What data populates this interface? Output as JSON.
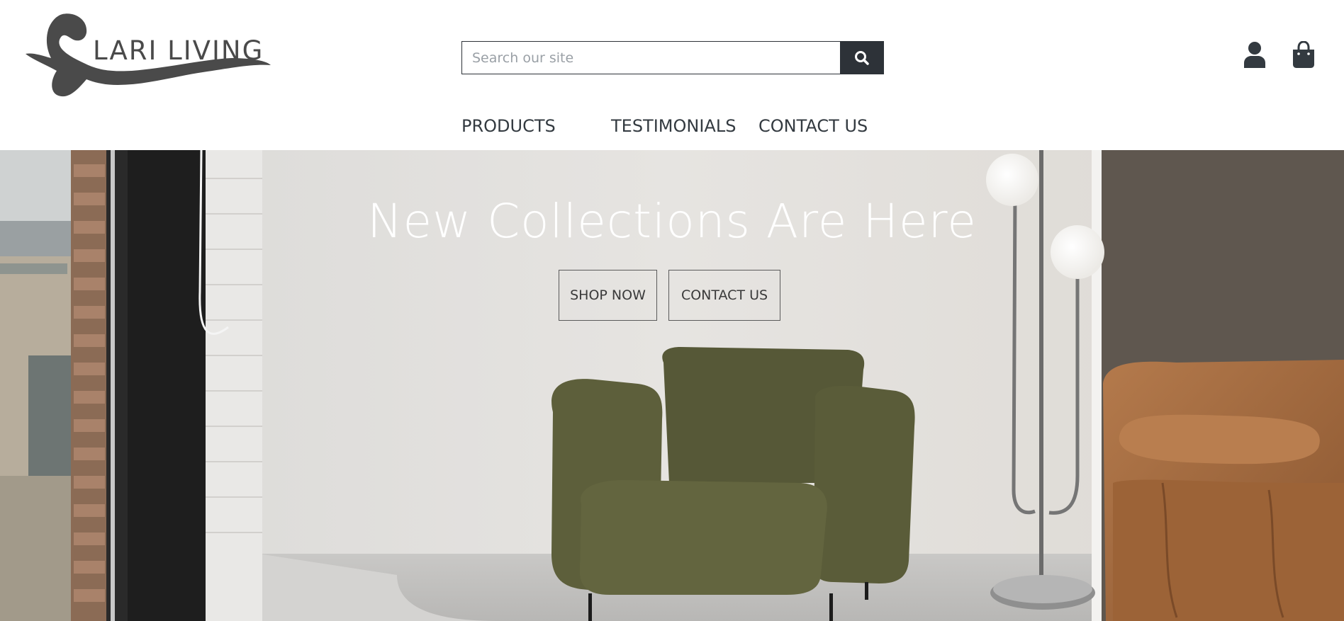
{
  "brand": {
    "name": "LARI LIVING"
  },
  "search": {
    "placeholder": "Search our site",
    "value": ""
  },
  "header_icons": [
    "user-icon",
    "shopping-bag-icon",
    "search-icon"
  ],
  "nav": {
    "items": [
      {
        "label": "PRODUCTS"
      },
      {
        "label": "TESTIMONIALS"
      },
      {
        "label": "CONTACT US"
      }
    ]
  },
  "hero": {
    "title": "New Collections Are Here",
    "buttons": [
      {
        "label": "SHOP NOW"
      },
      {
        "label": "CONTACT US"
      }
    ]
  },
  "colors": {
    "text_dark": "#333a40",
    "search_button": "#2d3238",
    "hero_title": "#ffffff"
  }
}
